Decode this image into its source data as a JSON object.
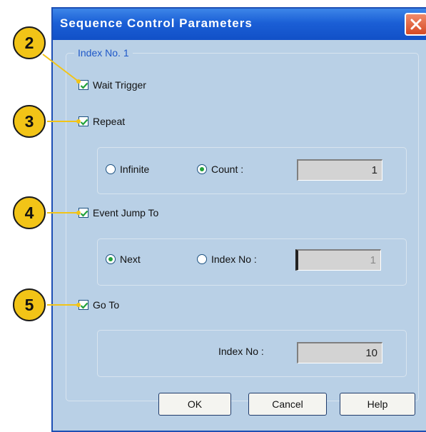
{
  "dialog": {
    "title": "Sequence Control Parameters",
    "group_label": "Index No. 1",
    "wait_trigger": {
      "label": "Wait Trigger",
      "checked": true
    },
    "repeat": {
      "label": "Repeat",
      "checked": true,
      "infinite_label": "Infinite",
      "count_label": "Count :",
      "selected": "Count",
      "count_value": "1"
    },
    "event_jump": {
      "label": "Event Jump To",
      "checked": true,
      "next_label": "Next",
      "index_label": "Index No :",
      "selected": "Next",
      "index_value": "1"
    },
    "go_to": {
      "label": "Go To",
      "checked": true,
      "index_label": "Index No :",
      "index_value": "10"
    },
    "buttons": {
      "ok": "OK",
      "cancel": "Cancel",
      "help": "Help"
    }
  },
  "callouts": [
    "2",
    "3",
    "4",
    "5"
  ],
  "colors": {
    "title_bar": "#1b5fd6",
    "dialog_bg": "#b9d0e6",
    "callout_fill": "#f2c417",
    "radio_selected": "#22a23a",
    "close_button": "#d64a24"
  },
  "icons": [
    "close-icon",
    "checkmark-icon",
    "radio-selected-dot"
  ]
}
